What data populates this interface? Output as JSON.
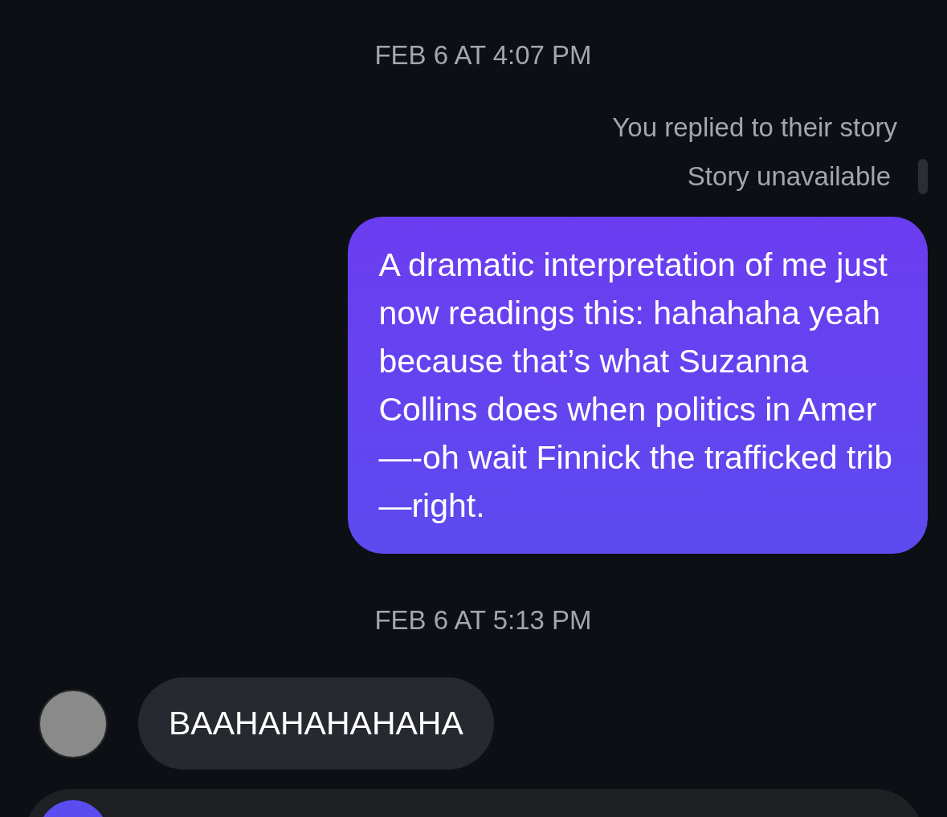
{
  "messages": [
    {
      "kind": "timestamp",
      "text": "FEB 6 AT 4:07 PM"
    },
    {
      "kind": "story_reply",
      "caption": "You replied to their story",
      "story": "Story unavailable"
    },
    {
      "kind": "sent",
      "text": "A dramatic interpretation of me just\nnow readings this: hahahaha yeah\nbecause that’s what Suzanna\nCollins does when politics in Amer\n—-oh wait Finnick the trafficked trib\n—right."
    },
    {
      "kind": "timestamp",
      "text": "FEB 6 AT 5:13 PM"
    },
    {
      "kind": "received",
      "text": "BAAHAHAHAHAHA"
    }
  ]
}
